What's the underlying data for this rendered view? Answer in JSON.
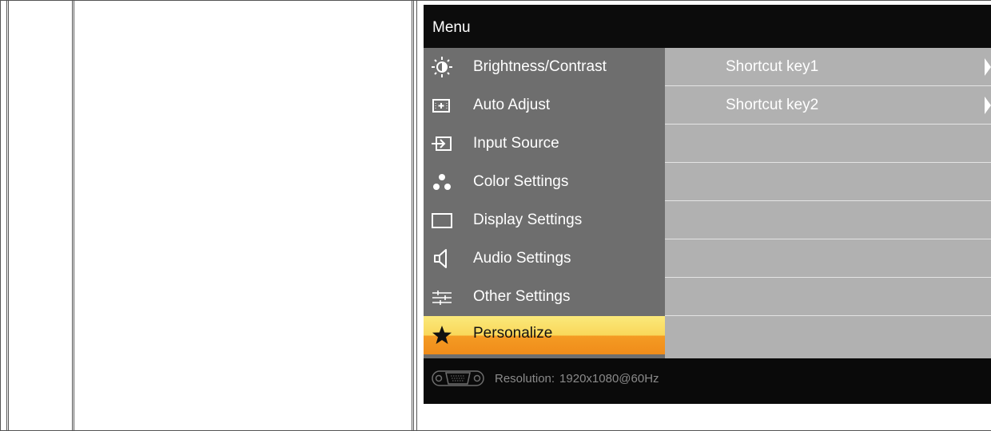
{
  "osd": {
    "title": "Menu",
    "menu_items": [
      {
        "label": "Brightness/Contrast",
        "icon": "brightness-icon"
      },
      {
        "label": "Auto Adjust",
        "icon": "auto-adjust-icon"
      },
      {
        "label": "Input Source",
        "icon": "input-source-icon"
      },
      {
        "label": "Color Settings",
        "icon": "color-settings-icon"
      },
      {
        "label": "Display Settings",
        "icon": "display-settings-icon"
      },
      {
        "label": "Audio Settings",
        "icon": "speaker-icon"
      },
      {
        "label": "Other Settings",
        "icon": "sliders-icon"
      },
      {
        "label": "Personalize",
        "icon": "star-icon",
        "selected": true
      }
    ],
    "submenu": [
      {
        "label": "Shortcut key1"
      },
      {
        "label": "Shortcut key2"
      },
      {
        "label": ""
      },
      {
        "label": ""
      },
      {
        "label": ""
      },
      {
        "label": ""
      },
      {
        "label": ""
      },
      {
        "label": ""
      }
    ],
    "footer": {
      "resolution_label": "Resolution:",
      "resolution_value": "1920x1080@60Hz",
      "icon": "vga-connector-icon"
    }
  },
  "colors": {
    "menu_bg": "#6e6e6e",
    "submenu_bg": "#b1b1b1",
    "selected_top": "#fbe97b",
    "selected_bottom": "#f08c1a",
    "osd_bg": "#000000"
  }
}
